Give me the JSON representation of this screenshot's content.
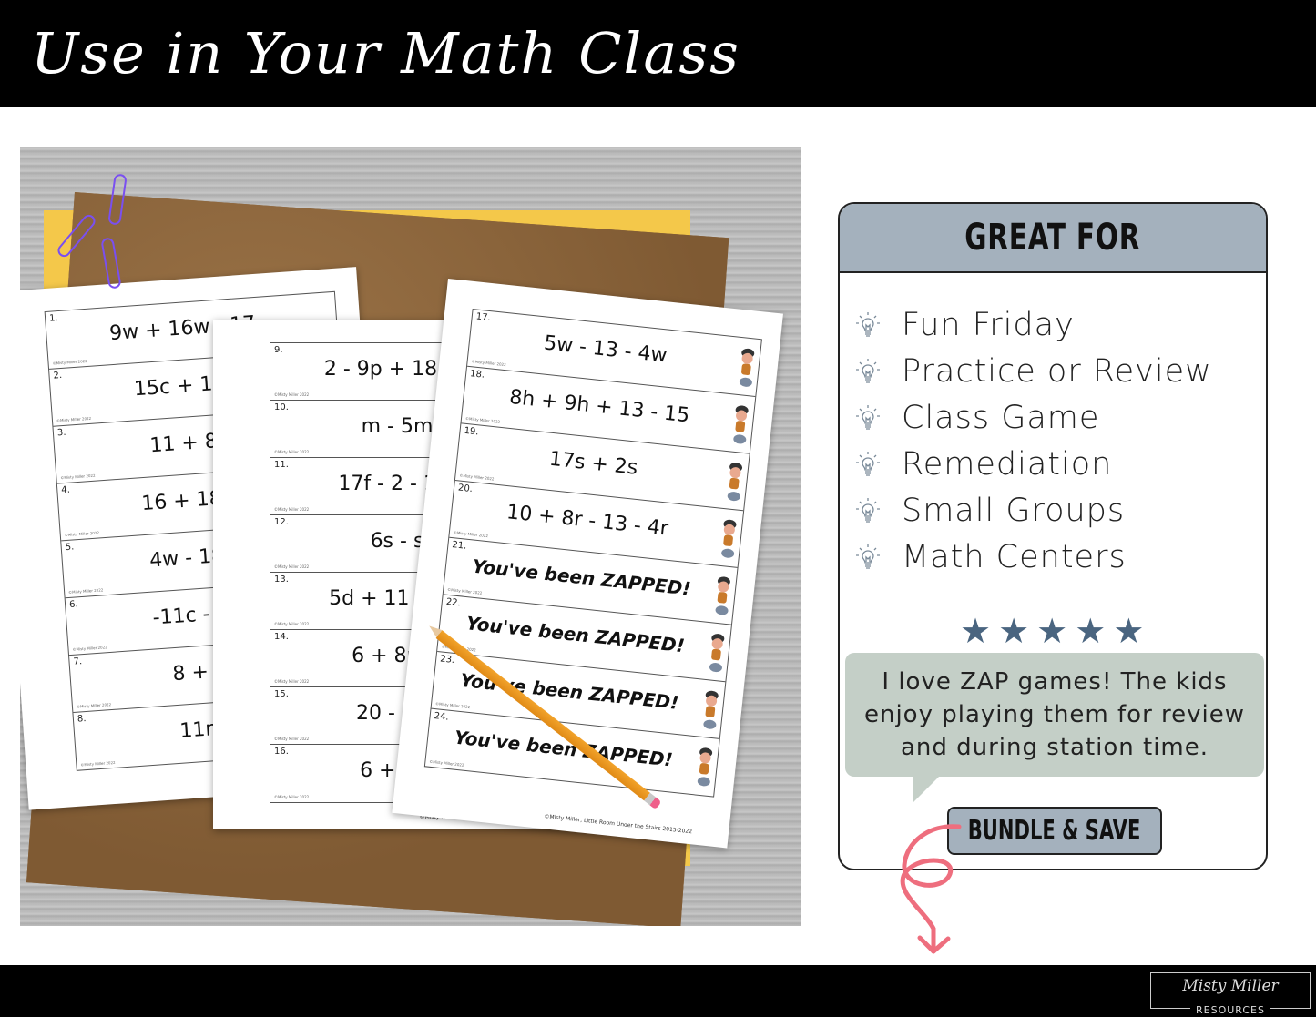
{
  "header": {
    "title": "Use in Your Math Class"
  },
  "photo": {
    "sheet_left": {
      "cards": [
        {
          "num": "1.",
          "expr": "9w + 16w - 17"
        },
        {
          "num": "2.",
          "expr": "15c + 10 -"
        },
        {
          "num": "3.",
          "expr": "11 + 8 -"
        },
        {
          "num": "4.",
          "expr": "16 + 18y -"
        },
        {
          "num": "5.",
          "expr": "4w - 18 +"
        },
        {
          "num": "6.",
          "expr": "-11c - 5 +"
        },
        {
          "num": "7.",
          "expr": "8 + 5h"
        },
        {
          "num": "8.",
          "expr": "11n +"
        }
      ]
    },
    "sheet_middle": {
      "cards": [
        {
          "num": "9.",
          "expr": "2 - 9p + 18 - 5"
        },
        {
          "num": "10.",
          "expr": "m - 5m"
        },
        {
          "num": "11.",
          "expr": "17f - 2 - 16f"
        },
        {
          "num": "12.",
          "expr": "6s - s"
        },
        {
          "num": "13.",
          "expr": "5d + 11 + 3 -"
        },
        {
          "num": "14.",
          "expr": "6 + 8p +"
        },
        {
          "num": "15.",
          "expr": "20 - 15c"
        },
        {
          "num": "16.",
          "expr": "6 + 3m"
        }
      ],
      "footer": "©Misty Miller, Little Room Under the Stairs 2015-2022"
    },
    "sheet_right": {
      "cards": [
        {
          "num": "17.",
          "expr": "5w - 13 - 4w"
        },
        {
          "num": "18.",
          "expr": "8h + 9h + 13 - 15"
        },
        {
          "num": "19.",
          "expr": "17s + 2s"
        },
        {
          "num": "20.",
          "expr": "10 + 8r - 13 - 4r"
        },
        {
          "num": "21.",
          "expr": "You've been ZAPPED!"
        },
        {
          "num": "22.",
          "expr": "You've been ZAPPED!"
        },
        {
          "num": "23.",
          "expr": "You've been ZAPPED!"
        },
        {
          "num": "24.",
          "expr": "You've been ZAPPED!"
        }
      ],
      "footer": "©Misty Miller, Little Room Under the Stairs 2015-2022"
    },
    "card_copyright": "©Misty Miller 2022"
  },
  "panel": {
    "title": "GREAT FOR",
    "uses": [
      {
        "icon": "lightbulb-icon",
        "label": "Fun Friday"
      },
      {
        "icon": "lightbulb-icon",
        "label": "Practice or Review"
      },
      {
        "icon": "lightbulb-icon",
        "label": "Class Game"
      },
      {
        "icon": "lightbulb-icon",
        "label": "Remediation"
      },
      {
        "icon": "lightbulb-icon",
        "label": "Small Groups"
      },
      {
        "icon": "lightbulb-icon",
        "label": "Math Centers"
      }
    ],
    "rating": {
      "value": 5,
      "max": 5,
      "glyph": "★"
    },
    "testimonial": "I love ZAP games! The kids enjoy playing them for review and during station time.",
    "bundle_button": "BUNDLE & SAVE"
  },
  "footer": {
    "brand_name": "Misty Miller",
    "brand_sub": "RESOURCES"
  },
  "colors": {
    "header_bg": "#000000",
    "panel_header": "#a4b1bd",
    "star": "#4a6580",
    "bubble": "#c4cfc7",
    "arrow": "#ee6e7e"
  }
}
